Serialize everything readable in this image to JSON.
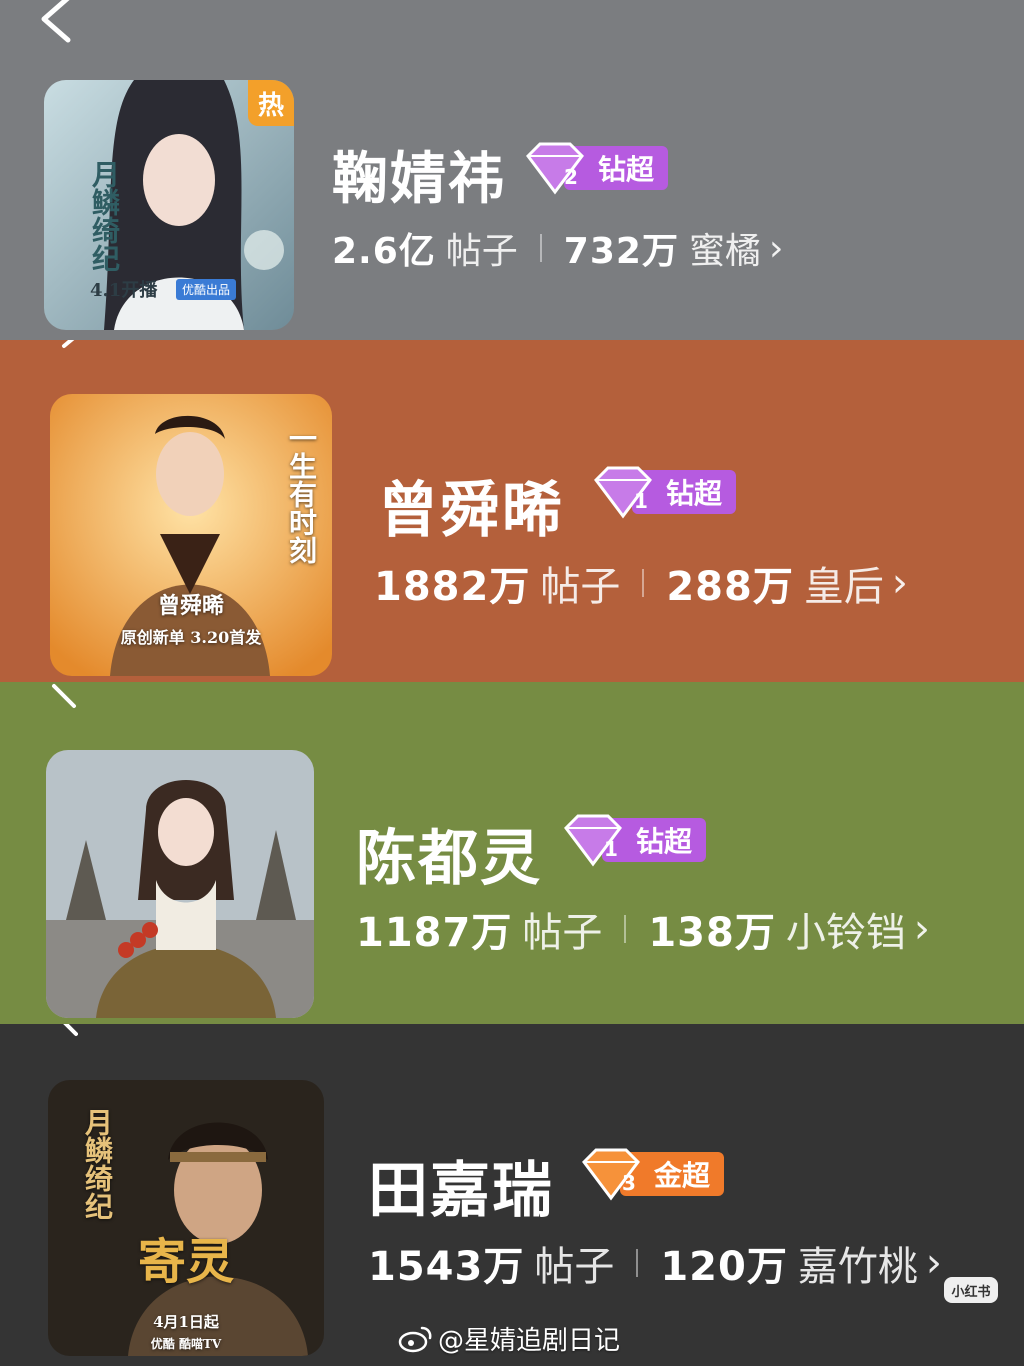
{
  "header": {
    "back_icon": "chevron-left-icon"
  },
  "colors": {
    "panel_1": "#7b7d80",
    "panel_2": "#b4603b",
    "panel_3": "#768c43",
    "panel_4": "#343434",
    "diamond_pill": "#b65be0",
    "gold_pill": "#f07a2a",
    "hot_badge": "#f3a02a"
  },
  "entries": [
    {
      "name": "鞠婧祎",
      "tier_level": "2",
      "tier_label": "钻超",
      "posts_count": "2.6亿",
      "posts_label": "帖子",
      "fans_count": "732万",
      "fans_label": "蜜橘",
      "cover": {
        "hot_badge": "热",
        "title_art": "月鳞绮纪",
        "release": "4.1开播",
        "producer": "优酷出品"
      }
    },
    {
      "name": "曾舜晞",
      "tier_level": "1",
      "tier_label": "钻超",
      "posts_count": "1882万",
      "posts_label": "帖子",
      "fans_count": "288万",
      "fans_label": "皇后",
      "cover": {
        "title_art": "一生有时刻",
        "artist": "曾舜晞",
        "release": "原创新单 3.20首发"
      }
    },
    {
      "name": "陈都灵",
      "tier_level": "1",
      "tier_label": "钻超",
      "posts_count": "1187万",
      "posts_label": "帖子",
      "fans_count": "138万",
      "fans_label": "小铃铛",
      "cover": {}
    },
    {
      "name": "田嘉瑞",
      "tier_level": "3",
      "tier_label": "金超",
      "posts_count": "1543万",
      "posts_label": "帖子",
      "fans_count": "120万",
      "fans_label": "嘉竹桃",
      "cover": {
        "title_art": "月鳞绮纪",
        "role": "寄灵",
        "release": "4月1日起",
        "platforms": "优酷 酷喵TV"
      }
    }
  ],
  "watermark": {
    "badge": "小红书",
    "weibo_handle": "@星婧追剧日记"
  }
}
